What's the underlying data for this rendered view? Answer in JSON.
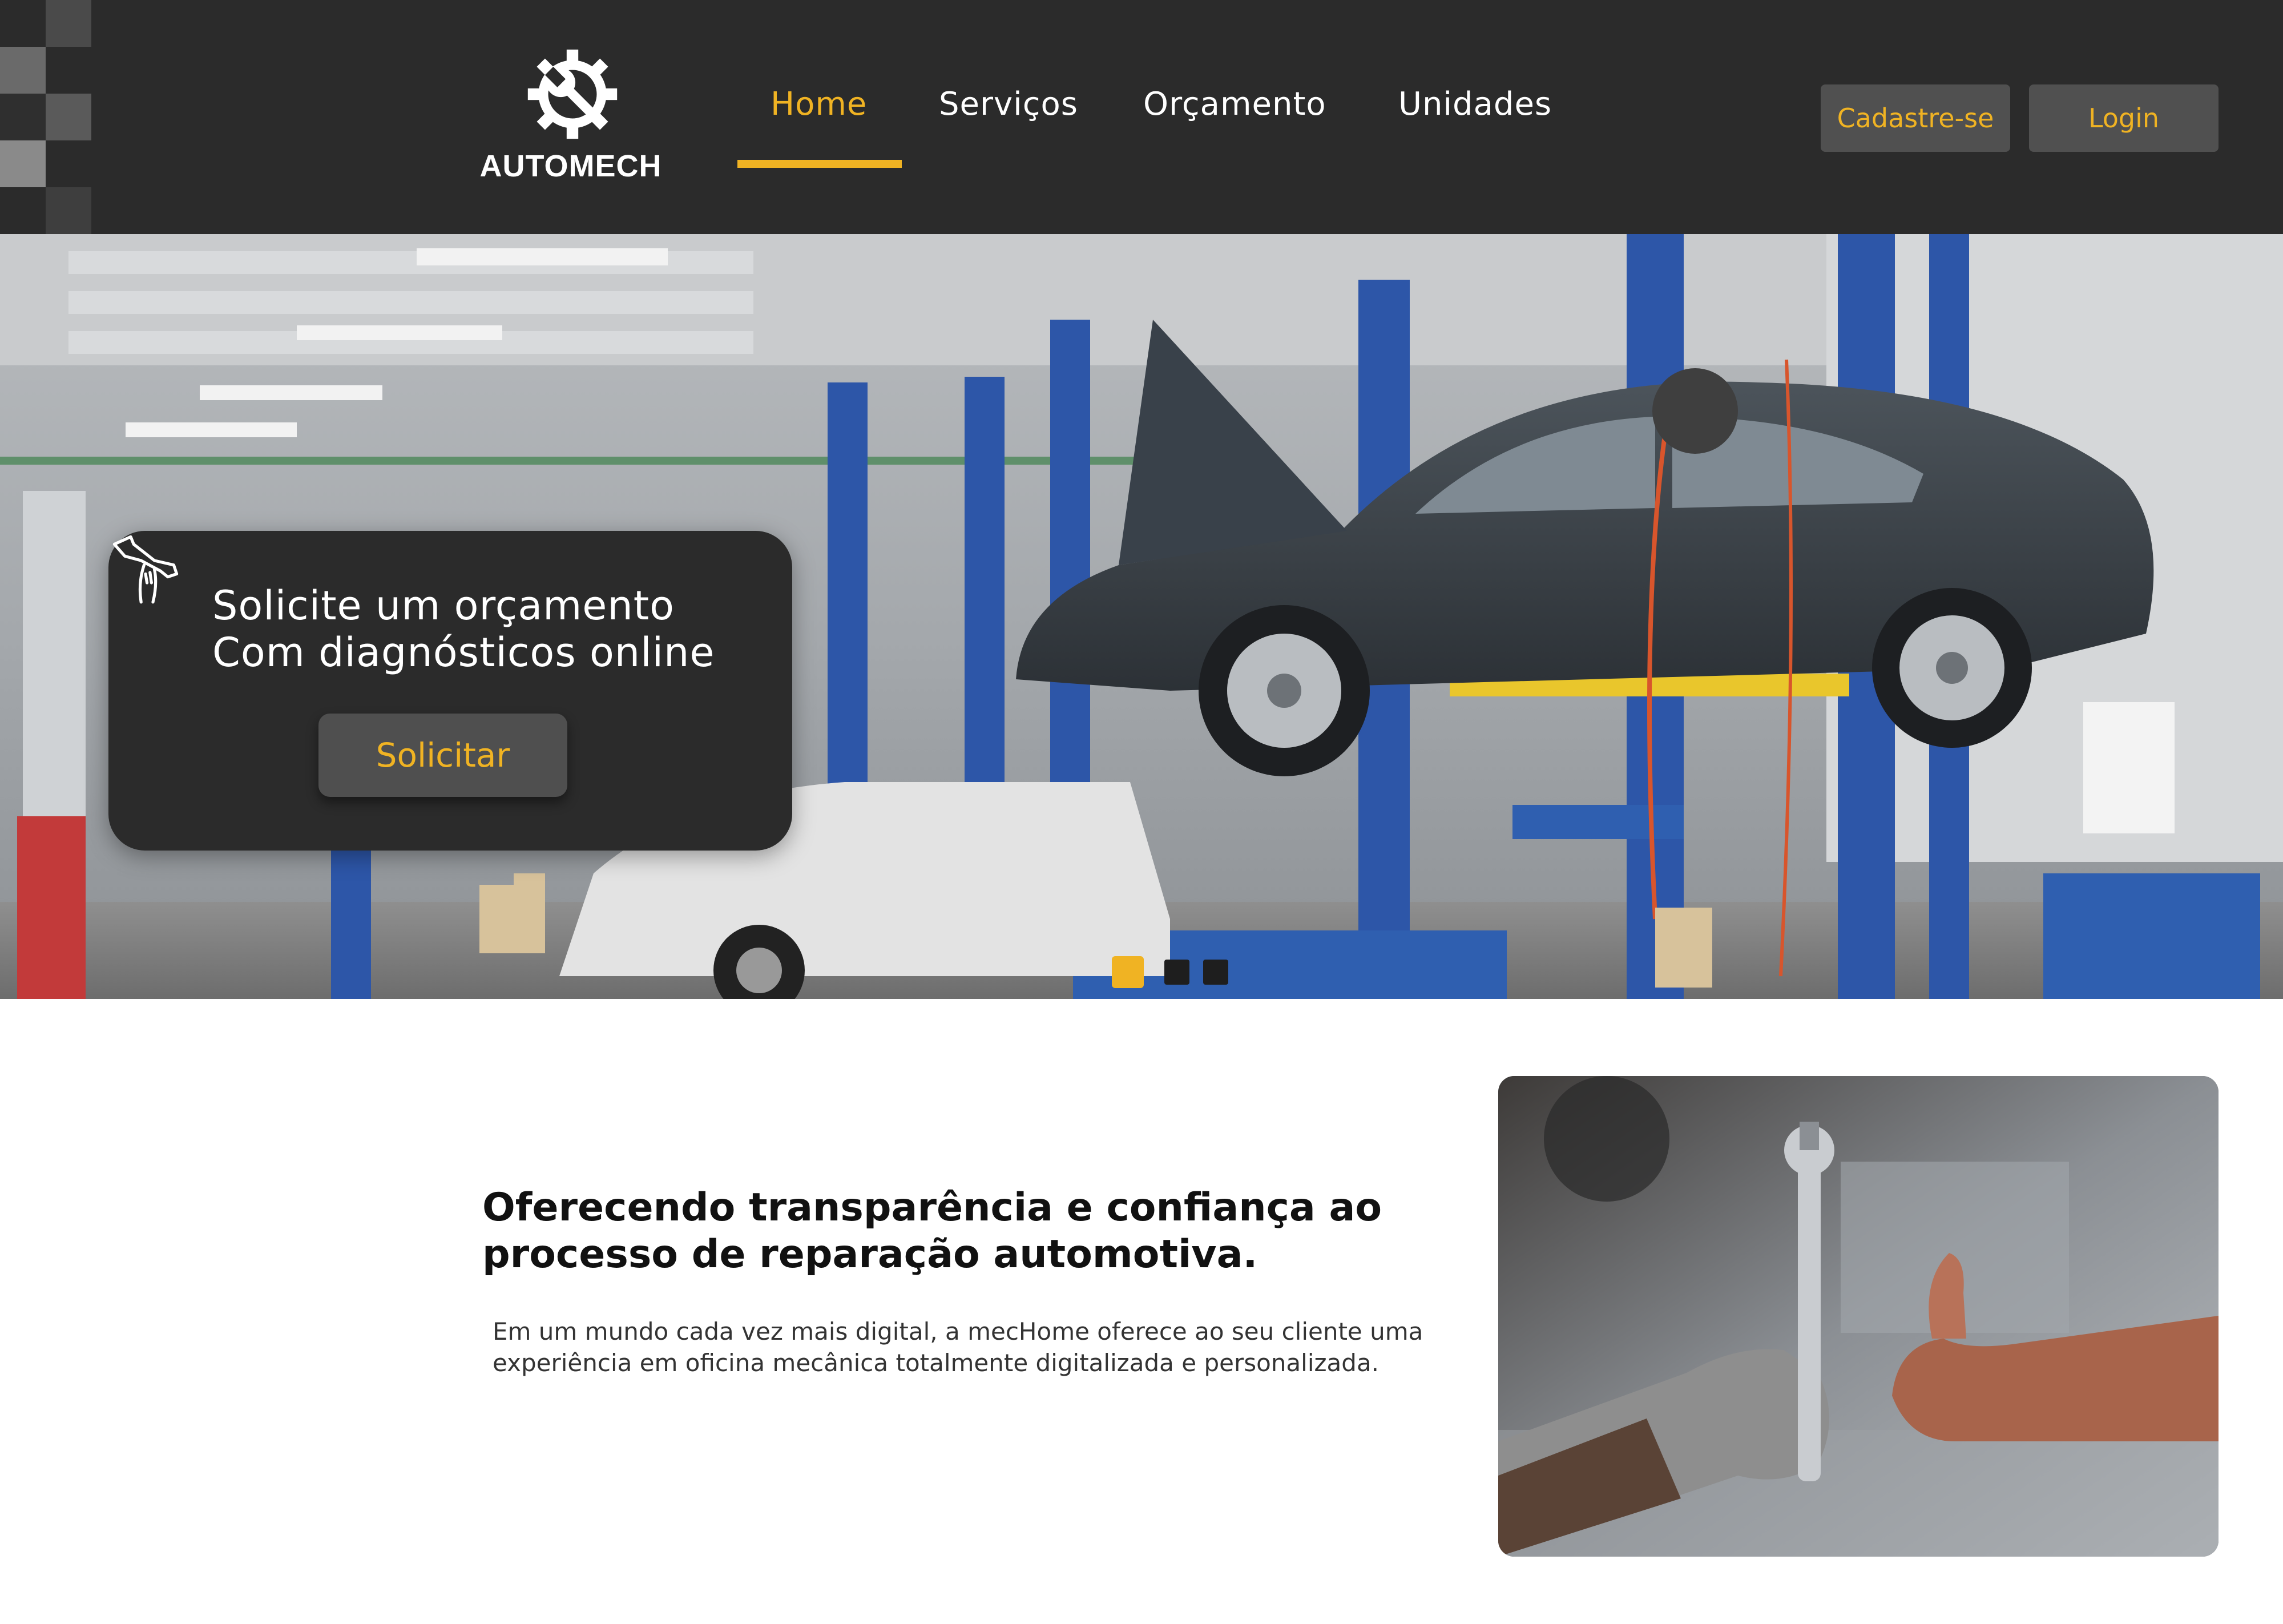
{
  "brand": {
    "name": "AUTOMECH"
  },
  "colors": {
    "accent": "#f0b323",
    "header_bg": "#2b2b2b",
    "button_bg": "#505050",
    "card_bg": "#2b2b2b"
  },
  "nav": {
    "items": [
      {
        "label": "Home",
        "active": true
      },
      {
        "label": "Serviços",
        "active": false
      },
      {
        "label": "Orçamento",
        "active": false
      },
      {
        "label": "Unidades",
        "active": false
      }
    ]
  },
  "auth": {
    "signup_label": "Cadastre-se",
    "login_label": "Login"
  },
  "hero": {
    "line1": "Solicite um orçamento",
    "line2": "Com diagnósticos online",
    "cta_label": "Solicitar",
    "icon": "wrench-hand-icon",
    "carousel": {
      "slide_count": 3,
      "active_index": 0
    }
  },
  "content": {
    "headline_line1": "Oferecendo transparência e confiança ao",
    "headline_line2": "processo de reparação automotiva.",
    "body_line1": "Em um mundo cada vez mais digital, a mecHome oferece ao seu cliente uma",
    "body_line2": "experiência em oficina mecânica totalmente digitalizada e personalizada."
  }
}
